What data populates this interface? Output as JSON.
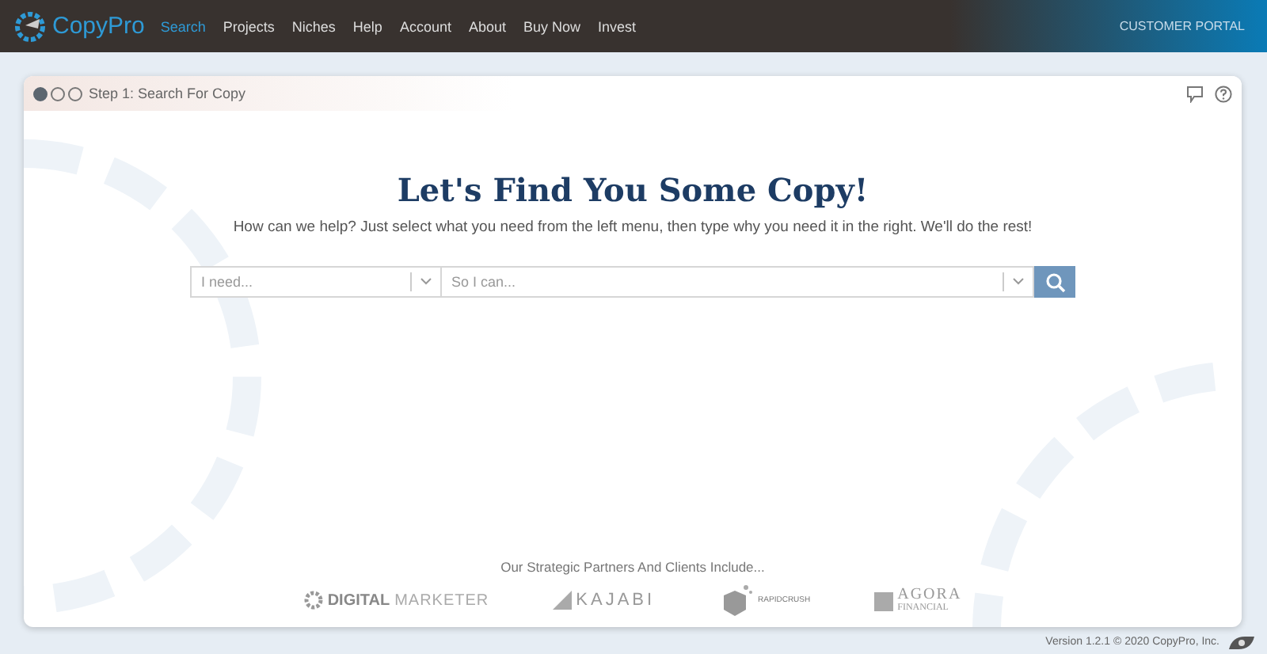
{
  "nav": {
    "brand": "CopyPro",
    "items": [
      {
        "label": "Search",
        "selected": true
      },
      {
        "label": "Projects",
        "selected": false
      },
      {
        "label": "Niches",
        "selected": false
      },
      {
        "label": "Help",
        "selected": false
      },
      {
        "label": "Account",
        "selected": false
      },
      {
        "label": "About",
        "selected": false
      },
      {
        "label": "Buy Now",
        "selected": false
      },
      {
        "label": "Invest",
        "selected": false
      }
    ],
    "portal": "CUSTOMER PORTAL"
  },
  "panel": {
    "steps": [
      {
        "selected": true
      },
      {
        "selected": false
      },
      {
        "selected": false
      }
    ],
    "title": "Step 1: Search For Copy"
  },
  "hero": {
    "heading": "Let's Find You Some Copy!",
    "subtitle": "How can we help? Just select what you need from the left menu, then type why you need it in the right. We'll do the rest!"
  },
  "search": {
    "need": {
      "placeholder": "I need..."
    },
    "reason": {
      "placeholder": "So I can..."
    }
  },
  "partners": {
    "caption": "Our Strategic Partners And Clients Include...",
    "logos": [
      {
        "kind": "digital",
        "text": "DIGITAL",
        "text2": "MARKETER"
      },
      {
        "kind": "kajabi",
        "text": "KAJABI"
      },
      {
        "kind": "rapid",
        "text": "RAPIDCRUSH"
      },
      {
        "kind": "agora",
        "text": "AGORA",
        "text2": "FINANCIAL"
      }
    ]
  },
  "footer": "Version 1.2.1 © 2020 CopyPro, Inc."
}
